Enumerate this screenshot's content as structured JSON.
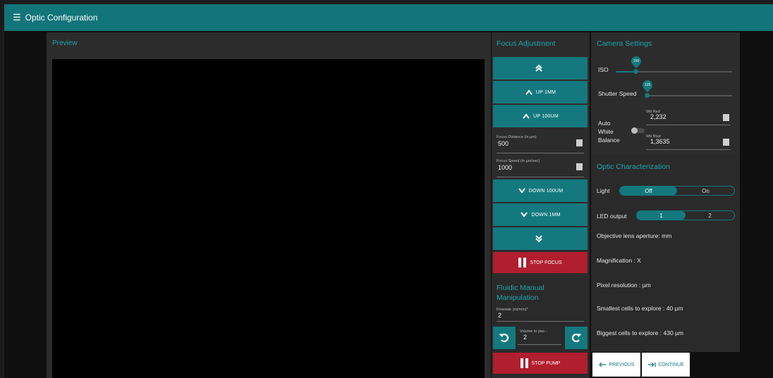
{
  "app": {
    "title": "Optic Configuration"
  },
  "preview": {
    "title": "Preview"
  },
  "focus": {
    "title": "Focus Adjustment",
    "up_1mm": "UP 1MM",
    "up_100um": "UP 100UM",
    "distance_label": "Focus Distance (in µm)",
    "distance_value": "500",
    "speed_label": "Focus Speed (in µm/sec)",
    "speed_value": "1000",
    "down_100um": "DOWN 100UM",
    "down_1mm": "DOWN 1MM",
    "stop_focus": "STOP FOCUS"
  },
  "fluidic": {
    "title": "Fluidic Manual Manipulation",
    "flowrate_label": "Flowrate (ml/min)*",
    "flowrate_value": "2",
    "volume_label": "Volume to pas...",
    "volume_value": "2",
    "stop_pump": "STOP PUMP"
  },
  "camera": {
    "title": "Camera Settings",
    "iso_label": "ISO",
    "iso_value": "150",
    "shutter_label": "Shutter Speed",
    "shutter_value": "125",
    "awb_label": "Auto White Balance",
    "awb_enabled": false,
    "wb_red_label": "Wb Red",
    "wb_red_value": "2,232",
    "wb_blue_label": "Wb Blue",
    "wb_blue_value": "1,3635"
  },
  "optic": {
    "title": "Optic Characterization",
    "light_label": "Light",
    "light_options": [
      "Off",
      "On"
    ],
    "light_selected": "Off",
    "led_label": "LED output",
    "led_options": [
      "1",
      "2"
    ],
    "led_selected": "1",
    "aperture": "Objective lens aperture: mm",
    "magnification": "Magnification : X",
    "pixel_res": "Pixel resolution : µm",
    "smallest": "Smallest cells to explore : 40 µm",
    "biggest": "Biggest cells to explore : 430 µm"
  },
  "nav": {
    "previous": "PREVIOUS",
    "continue": "CONTINUE"
  },
  "colors": {
    "accent": "#14797e",
    "danger": "#b11e2e",
    "topbar": "#11757a"
  }
}
